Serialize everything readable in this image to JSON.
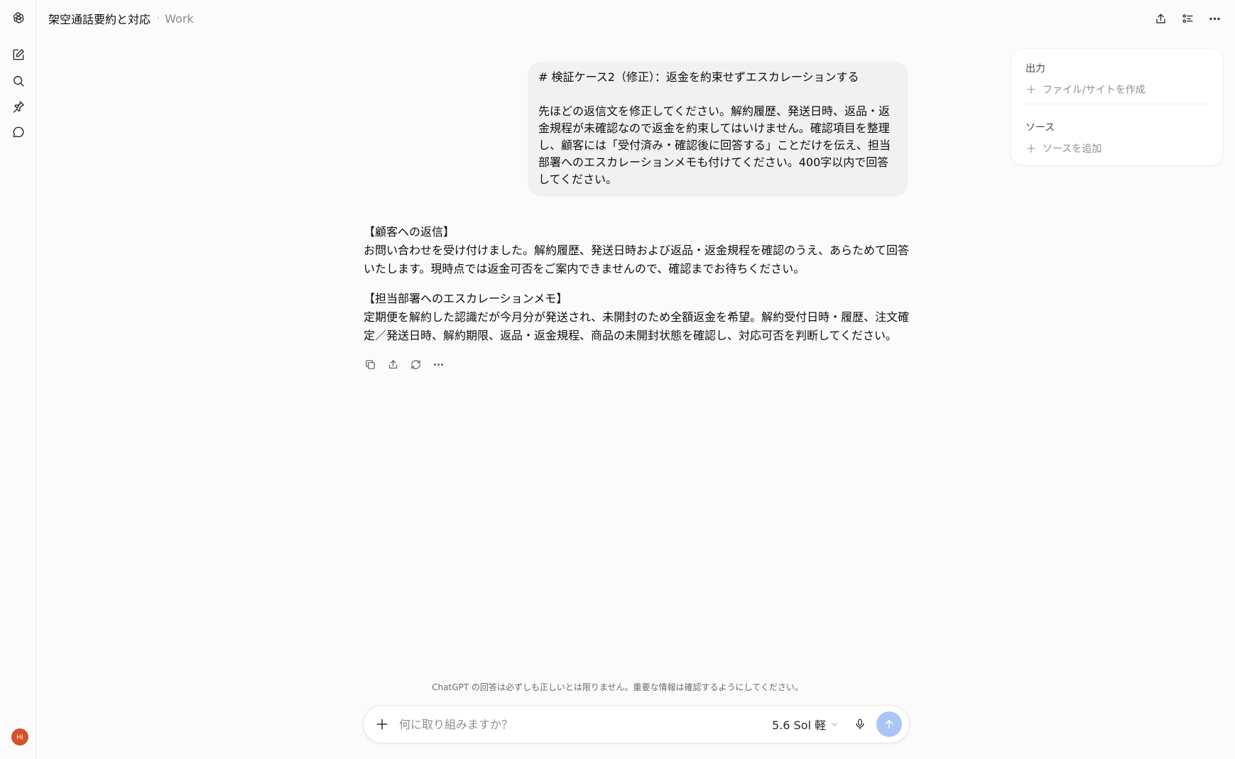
{
  "header": {
    "title": "架空通話要約と対応",
    "separator": "·",
    "project": "Work"
  },
  "icons": {
    "logo": "openai-logo-icon",
    "new_chat": "edit-icon",
    "search": "search-icon",
    "pin": "pin-icon",
    "chat": "chat-bubble-icon",
    "share": "share-icon",
    "tasks": "tasks-icon",
    "more": "more-icon"
  },
  "user": {
    "avatar_initials": "HI",
    "avatar_color": "#d2532a"
  },
  "conversation": {
    "user_message": {
      "line1": "# 検証ケース2（修正）：返金を約束せずエスカレーションする",
      "line2": "先ほどの返信文を修正してください。解約履歴、発送日時、返品・返金規程が未確認なので返金を約束してはいけません。確認項目を整理し、顧客には「受付済み・確認後に回答する」ことだけを伝え、担当部署へのエスカレーションメモも付けてください。400字以内で回答してください。"
    },
    "assistant_message": {
      "customer_heading": "【顧客への返信】",
      "customer_body": "お問い合わせを受け付けました。解約履歴、発送日時および返品・返金規程を確認のうえ、あらためて回答いたします。現時点では返金可否をご案内できませんので、確認までお待ちください。",
      "memo_heading": "【担当部署へのエスカレーションメモ】",
      "memo_body": "定期便を解約した認識だが今月分が発送され、未開封のため全額返金を希望。解約受付日時・履歴、注文確定／発送日時、解約期限、返品・返金規程、商品の未開封状態を確認し、対応可否を判断してください。"
    },
    "actions": [
      "copy-icon",
      "share-icon",
      "regenerate-icon",
      "more-icon"
    ]
  },
  "panel": {
    "output_title": "出力",
    "output_add": "ファイル/サイトを作成",
    "sources_title": "ソース",
    "sources_add": "ソースを追加"
  },
  "composer": {
    "placeholder": "何に取り組みますか？",
    "model_label": "5.6 Sol 軽",
    "send_color": "#a9c6f5"
  },
  "footer": {
    "disclaimer": "ChatGPT の回答は必ずしも正しいとは限りません。重要な情報は確認するようにしてください。"
  }
}
